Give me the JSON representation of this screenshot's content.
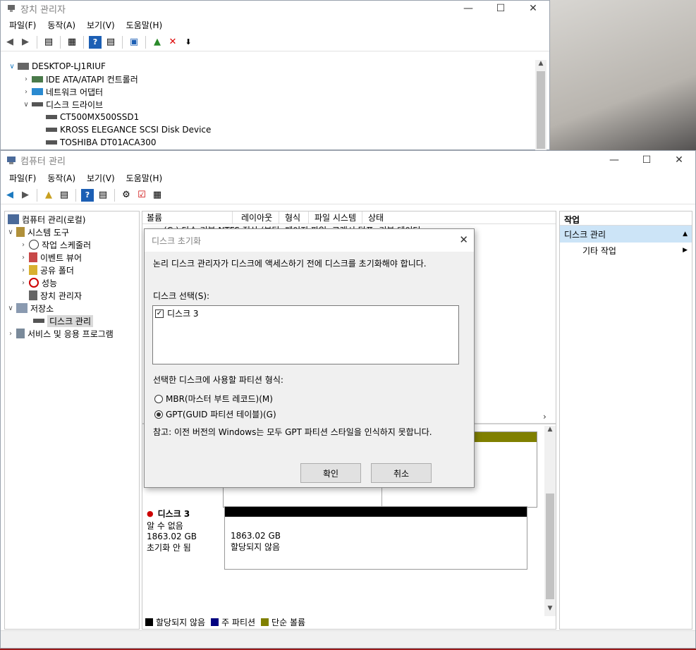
{
  "device_manager": {
    "title": "장치 관리자",
    "menu": [
      "파일(F)",
      "동작(A)",
      "보기(V)",
      "도움말(H)"
    ],
    "tree": {
      "root": "DESKTOP-LJ1RIUF",
      "items": [
        {
          "label": "IDE ATA/ATAPI 컨트롤러",
          "level": 1
        },
        {
          "label": "네트워크 어댑터",
          "level": 1
        },
        {
          "label": "디스크 드라이브",
          "level": 1
        },
        {
          "label": "CT500MX500SSD1",
          "level": 2
        },
        {
          "label": "KROSS ELEGANCE SCSI Disk Device",
          "level": 2
        },
        {
          "label": "TOSHIBA DT01ACA300",
          "level": 2
        }
      ]
    }
  },
  "computer_management": {
    "title": "컴퓨터 관리",
    "menu": [
      "파일(F)",
      "동작(A)",
      "보기(V)",
      "도움말(H)"
    ],
    "nav_tree": {
      "root": "컴퓨터 관리(로컬)",
      "system_tools": "시스템 도구",
      "task_scheduler": "작업 스케줄러",
      "event_viewer": "이벤트 뷰어",
      "shared_folders": "공유 폴더",
      "performance": "성능",
      "device_manager": "장치 관리자",
      "storage": "저장소",
      "disk_management": "디스크 관리",
      "services": "서비스 및 응용 프로그램"
    },
    "volume_table": {
      "headers": [
        "볼륨",
        "레이아웃",
        "형식",
        "파일 시스템",
        "상태"
      ],
      "partial_row": "(C:)  단순  기본  NTFS  정상 (부팅, 페이지 파일, 크래시 덤프, 기본 데이터"
    },
    "disk3": {
      "name": "디스크 3",
      "status": "알 수 없음",
      "size": "1863.02 GB",
      "init_state": "초기화 안 됨",
      "partition_size": "1863.02 GB",
      "partition_state": "할당되지 않음"
    },
    "legend": {
      "unallocated": "할당되지 않음",
      "primary": "주 파티션",
      "simple": "단순 볼륨"
    },
    "actions": {
      "header": "작업",
      "section": "디스크 관리",
      "more": "기타 작업"
    }
  },
  "dialog": {
    "title": "디스크 초기화",
    "message": "논리 디스크 관리자가 디스크에 액세스하기 전에 디스크를 초기화해야 합니다.",
    "select_label": "디스크 선택(S):",
    "disk_item": "디스크 3",
    "partition_label": "선택한 디스크에 사용할 파티션 형식:",
    "mbr_option": "MBR(마스터 부트 레코드)(M)",
    "gpt_option": "GPT(GUID 파티션 테이블)(G)",
    "note": "참고: 이전 버전의 Windows는 모두 GPT 파티션 스타일을 인식하지 못합니다.",
    "ok": "확인",
    "cancel": "취소",
    "selected_style": "GPT"
  },
  "colors": {
    "unallocated": "#000000",
    "primary": "#000080",
    "simple": "#808000",
    "selection": "#cce4f7"
  }
}
